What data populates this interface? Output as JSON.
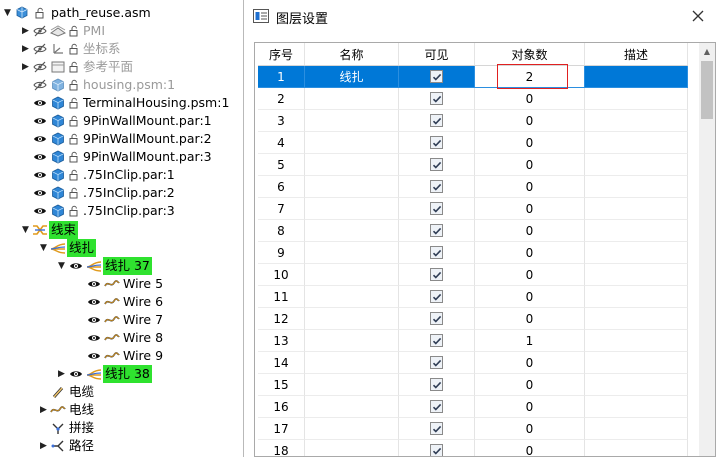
{
  "tree": {
    "root": {
      "label": "path_reuse.asm"
    },
    "items": [
      {
        "label": "PMI",
        "icon": "pmi-icon",
        "grey": true
      },
      {
        "label": "坐标系",
        "icon": "coordinate-system-icon",
        "grey": true
      },
      {
        "label": "参考平面",
        "icon": "reference-plane-icon",
        "grey": true
      },
      {
        "label": "housing.psm:1",
        "icon": "part-icon",
        "grey": true
      },
      {
        "label": "TerminalHousing.psm:1",
        "icon": "part-icon",
        "grey": false
      },
      {
        "label": "9PinWallMount.par:1",
        "icon": "part-icon",
        "grey": false
      },
      {
        "label": "9PinWallMount.par:2",
        "icon": "part-icon",
        "grey": false
      },
      {
        "label": "9PinWallMount.par:3",
        "icon": "part-icon",
        "grey": false
      },
      {
        "label": ".75InClip.par:1",
        "icon": "part-icon",
        "grey": false
      },
      {
        "label": ".75InClip.par:2",
        "icon": "part-icon",
        "grey": false
      },
      {
        "label": ".75InClip.par:3",
        "icon": "part-icon",
        "grey": false
      }
    ],
    "harness": {
      "label": "线束"
    },
    "bundle": {
      "label": "线扎"
    },
    "bundle37": {
      "label": "线扎 37"
    },
    "wires": [
      "Wire 5",
      "Wire 6",
      "Wire 7",
      "Wire 8",
      "Wire 9"
    ],
    "bundle38": {
      "label": "线扎 38"
    },
    "cable": {
      "label": "电缆"
    },
    "wire": {
      "label": "电线"
    },
    "splice": {
      "label": "拼接"
    },
    "path": {
      "label": "路径"
    }
  },
  "dialog": {
    "title": "图层设置",
    "columns": [
      "序号",
      "名称",
      "可见",
      "对象数",
      "描述"
    ],
    "rows": [
      {
        "index": "1",
        "name": "线扎",
        "visible": true,
        "count": "2",
        "desc": "",
        "selected": true
      },
      {
        "index": "2",
        "name": "",
        "visible": true,
        "count": "0",
        "desc": ""
      },
      {
        "index": "3",
        "name": "",
        "visible": true,
        "count": "0",
        "desc": ""
      },
      {
        "index": "4",
        "name": "",
        "visible": true,
        "count": "0",
        "desc": ""
      },
      {
        "index": "5",
        "name": "",
        "visible": true,
        "count": "0",
        "desc": ""
      },
      {
        "index": "6",
        "name": "",
        "visible": true,
        "count": "0",
        "desc": ""
      },
      {
        "index": "7",
        "name": "",
        "visible": true,
        "count": "0",
        "desc": ""
      },
      {
        "index": "8",
        "name": "",
        "visible": true,
        "count": "0",
        "desc": ""
      },
      {
        "index": "9",
        "name": "",
        "visible": true,
        "count": "0",
        "desc": ""
      },
      {
        "index": "10",
        "name": "",
        "visible": true,
        "count": "0",
        "desc": ""
      },
      {
        "index": "11",
        "name": "",
        "visible": true,
        "count": "0",
        "desc": ""
      },
      {
        "index": "12",
        "name": "",
        "visible": true,
        "count": "0",
        "desc": ""
      },
      {
        "index": "13",
        "name": "",
        "visible": true,
        "count": "1",
        "desc": ""
      },
      {
        "index": "14",
        "name": "",
        "visible": true,
        "count": "0",
        "desc": ""
      },
      {
        "index": "15",
        "name": "",
        "visible": true,
        "count": "0",
        "desc": ""
      },
      {
        "index": "16",
        "name": "",
        "visible": true,
        "count": "0",
        "desc": ""
      },
      {
        "index": "17",
        "name": "",
        "visible": true,
        "count": "0",
        "desc": ""
      },
      {
        "index": "18",
        "name": "",
        "visible": true,
        "count": "0",
        "desc": ""
      }
    ]
  },
  "colors": {
    "selection": "#0078d7",
    "highlight": "#2fe22f",
    "count_box": "#e02020"
  }
}
